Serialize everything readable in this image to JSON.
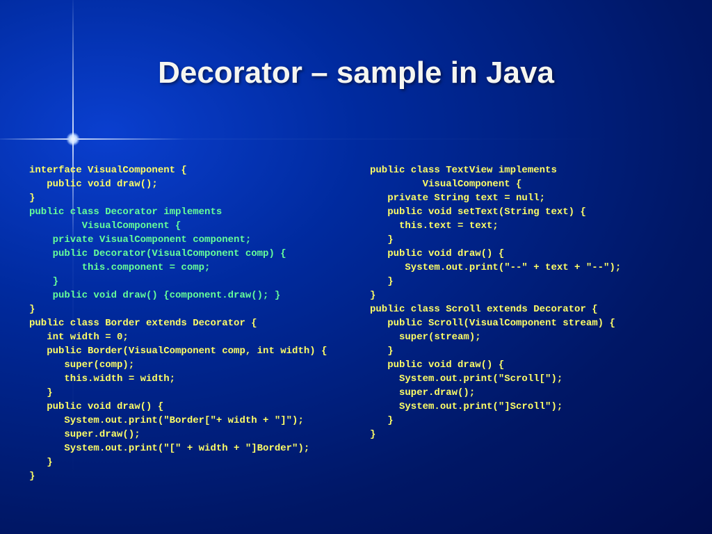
{
  "title": "Decorator – sample in Java",
  "left": {
    "l01": "interface VisualComponent {",
    "l02": "   public void draw();",
    "l03": "}",
    "l04": "public class Decorator implements",
    "l05": "         VisualComponent {",
    "l06": "    private VisualComponent component;",
    "l07": "    public Decorator(VisualComponent comp) {",
    "l08": "         this.component = comp;",
    "l09": "    }",
    "l10": "    public void draw() {component.draw(); }",
    "l11": "}",
    "l12": "public class Border extends Decorator {",
    "l13": "   int width = 0;",
    "l14": "   public Border(VisualComponent comp, int width) {",
    "l15": "      super(comp);",
    "l16": "      this.width = width;",
    "l17": "   }",
    "l18": "   public void draw() {",
    "l19": "      System.out.print(\"Border[\"+ width + \"]\");",
    "l20": "      super.draw();",
    "l21": "      System.out.print(\"[\" + width + \"]Border\");",
    "l22": "   }",
    "l23": "}"
  },
  "right": {
    "r01": "public class TextView implements",
    "r02": "         VisualComponent {",
    "r03": "   private String text = null;",
    "r04": "   public void setText(String text) {",
    "r05": "     this.text = text;",
    "r06": "   }",
    "r07": "   public void draw() {",
    "r08": "      System.out.print(\"--\" + text + \"--\");",
    "r09": "   }",
    "r10": "}",
    "r11": "public class Scroll extends Decorator {",
    "r12": "   public Scroll(VisualComponent stream) {",
    "r13": "     super(stream);",
    "r14": "   }",
    "r15": "   public void draw() {",
    "r16": "     System.out.print(\"Scroll[\");",
    "r17": "     super.draw();",
    "r18": "     System.out.print(\"]Scroll\");",
    "r19": "   }",
    "r20": "}"
  }
}
